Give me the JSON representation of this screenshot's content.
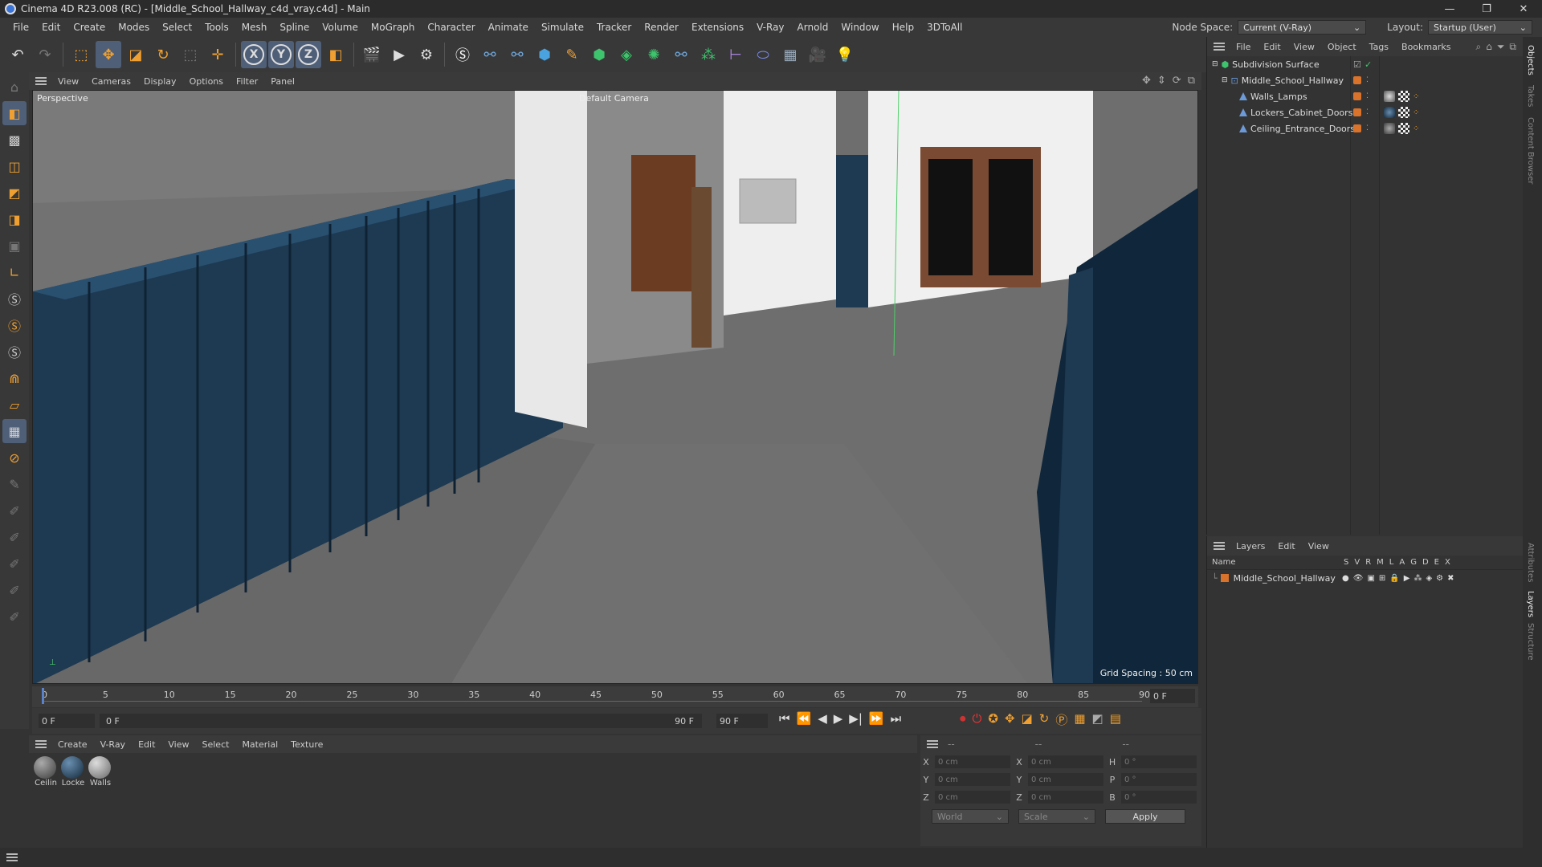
{
  "window": {
    "title": "Cinema 4D R23.008 (RC) - [Middle_School_Hallway_c4d_vray.c4d] - Main",
    "min": "—",
    "restore": "❐",
    "close": "✕"
  },
  "menu": [
    "File",
    "Edit",
    "Create",
    "Modes",
    "Select",
    "Tools",
    "Mesh",
    "Spline",
    "Volume",
    "MoGraph",
    "Character",
    "Animate",
    "Simulate",
    "Tracker",
    "Render",
    "Extensions",
    "V-Ray",
    "Arnold",
    "Window",
    "Help",
    "3DToAll"
  ],
  "nodespace": {
    "label": "Node Space:",
    "value": "Current (V-Ray)"
  },
  "layout": {
    "label": "Layout:",
    "value": "Startup (User)"
  },
  "viewport_menu": [
    "View",
    "Cameras",
    "Display",
    "Options",
    "Filter",
    "Panel"
  ],
  "viewport": {
    "name": "Perspective",
    "camera": "Default Camera",
    "grid": "Grid Spacing : 50 cm"
  },
  "objects_menu": [
    "File",
    "Edit",
    "View",
    "Object",
    "Tags",
    "Bookmarks"
  ],
  "objects": [
    {
      "name": "Subdivision Surface",
      "indent": 0
    },
    {
      "name": "Middle_School_Hallway",
      "indent": 1
    },
    {
      "name": "Walls_Lamps",
      "indent": 2
    },
    {
      "name": "Lockers_Cabinet_Doors",
      "indent": 2
    },
    {
      "name": "Ceiling_Entrance_Doors",
      "indent": 2
    }
  ],
  "layers_menu": [
    "Layers",
    "Edit",
    "View"
  ],
  "layers_header": {
    "name": "Name",
    "cols": [
      "S",
      "V",
      "R",
      "M",
      "L",
      "A",
      "G",
      "D",
      "E",
      "X"
    ]
  },
  "layers": [
    {
      "name": "Middle_School_Hallway"
    }
  ],
  "timeline_ticks": [
    "0",
    "5",
    "10",
    "15",
    "20",
    "25",
    "30",
    "35",
    "40",
    "45",
    "50",
    "55",
    "60",
    "65",
    "70",
    "75",
    "80",
    "85",
    "90"
  ],
  "timeline_end": "0 F",
  "transport": {
    "start": "0 F",
    "current": "0 F",
    "end": "90 F",
    "end2": "90 F"
  },
  "material_menu": [
    "Create",
    "V-Ray",
    "Edit",
    "View",
    "Select",
    "Material",
    "Texture"
  ],
  "materials": [
    {
      "label": "Ceilin"
    },
    {
      "label": "Locke"
    },
    {
      "label": "Walls"
    }
  ],
  "coords": {
    "rows": [
      {
        "a": "X",
        "av": "0 cm",
        "b": "X",
        "bv": "0 cm",
        "c": "H",
        "cv": "0 °"
      },
      {
        "a": "Y",
        "av": "0 cm",
        "b": "Y",
        "bv": "0 cm",
        "c": "P",
        "cv": "0 °"
      },
      {
        "a": "Z",
        "av": "0 cm",
        "b": "Z",
        "bv": "0 cm",
        "c": "B",
        "cv": "0 °"
      }
    ],
    "world": "World",
    "scale": "Scale",
    "apply": "Apply",
    "dash": "--"
  },
  "side_tabs": [
    "Objects",
    "Takes",
    "Content Browser",
    "Attributes",
    "Layers",
    "Structure"
  ]
}
